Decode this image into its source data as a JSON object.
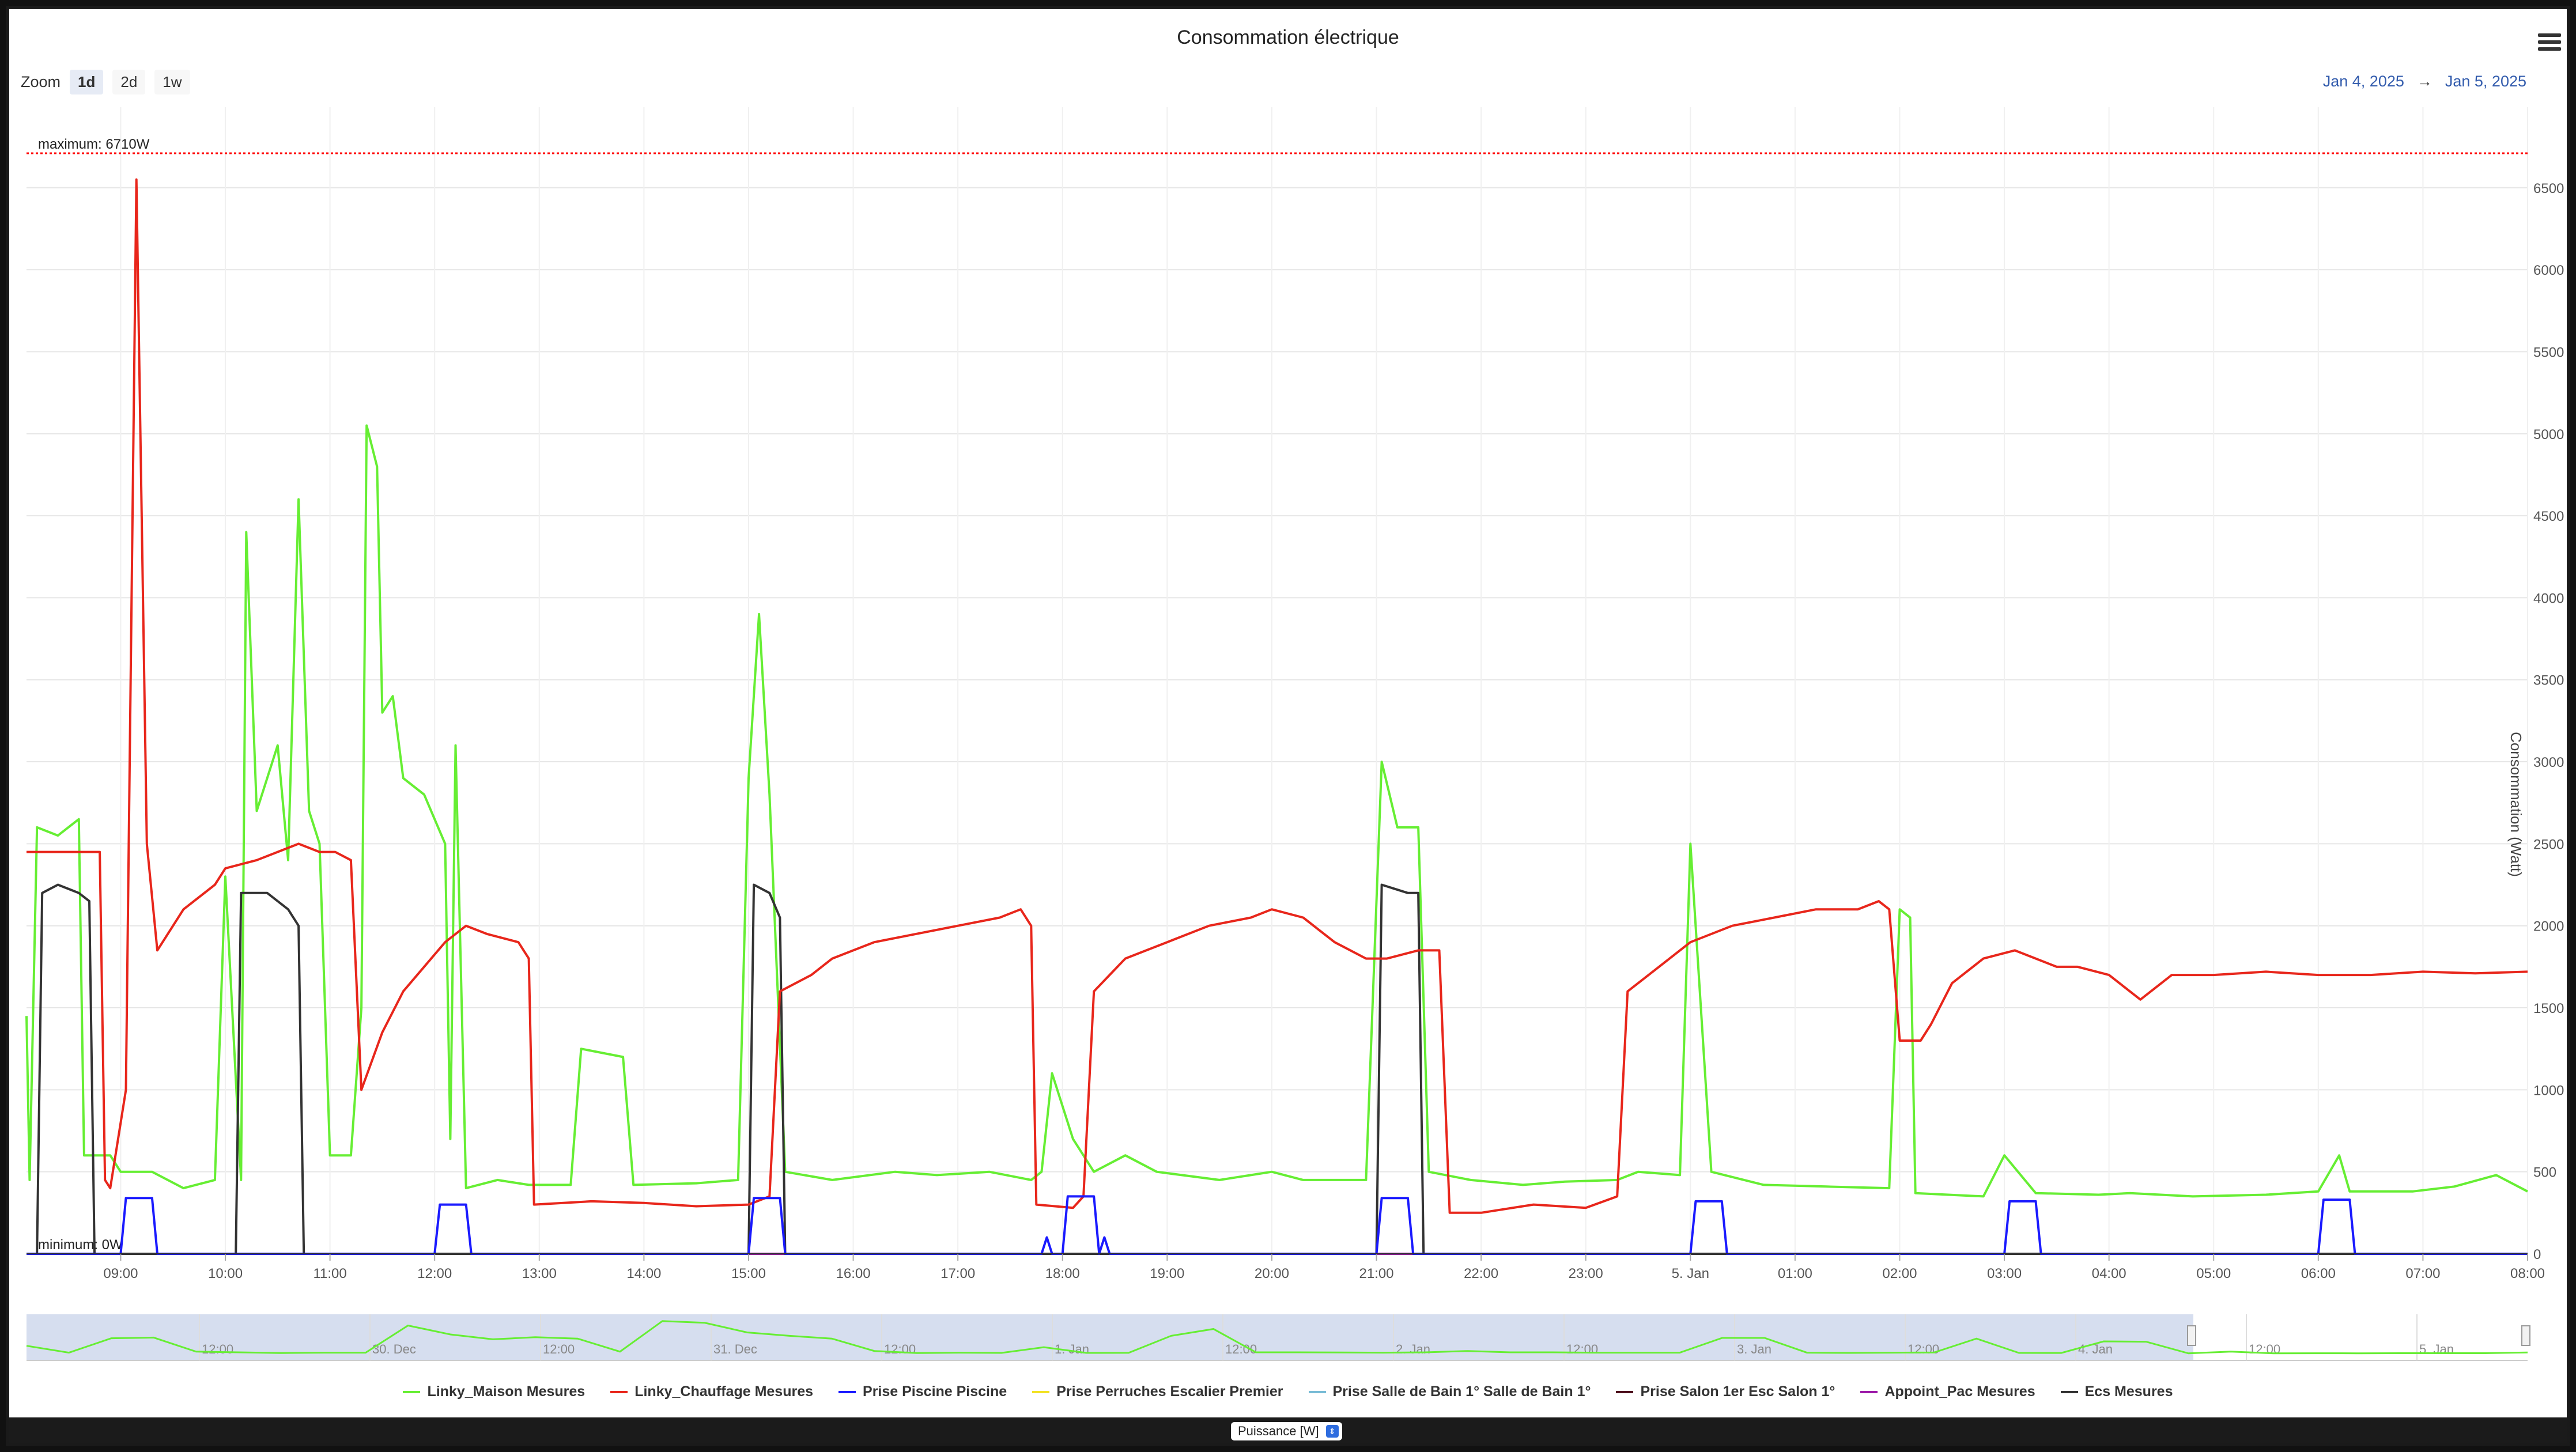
{
  "title": "Consommation électrique",
  "zoom": {
    "label": "Zoom",
    "options": [
      "1d",
      "2d",
      "1w"
    ],
    "selected": "1d"
  },
  "range": {
    "from": "Jan 4, 2025",
    "arrow": "→",
    "to": "Jan 5, 2025"
  },
  "unit_selector": "Puissance [W]",
  "navigator_labels": [
    "12:00",
    "30. Dec",
    "12:00",
    "31. Dec",
    "12:00",
    "1. Jan",
    "12:00",
    "2. Jan",
    "12:00",
    "3. Jan",
    "12:00",
    "4. Jan",
    "12:00",
    "5. Jan"
  ],
  "chart_data": {
    "type": "line",
    "title": "Consommation électrique",
    "ylabel": "Consommation (Watt)",
    "ylim": [
      0,
      6710
    ],
    "yticks": [
      0,
      500,
      1000,
      1500,
      2000,
      2500,
      3000,
      3500,
      4000,
      4500,
      5000,
      5500,
      6000,
      6500
    ],
    "xlim": [
      8.1,
      32.0
    ],
    "xticks": [
      {
        "v": 9,
        "label": "09:00"
      },
      {
        "v": 10,
        "label": "10:00"
      },
      {
        "v": 11,
        "label": "11:00"
      },
      {
        "v": 12,
        "label": "12:00"
      },
      {
        "v": 13,
        "label": "13:00"
      },
      {
        "v": 14,
        "label": "14:00"
      },
      {
        "v": 15,
        "label": "15:00"
      },
      {
        "v": 16,
        "label": "16:00"
      },
      {
        "v": 17,
        "label": "17:00"
      },
      {
        "v": 18,
        "label": "18:00"
      },
      {
        "v": 19,
        "label": "19:00"
      },
      {
        "v": 20,
        "label": "20:00"
      },
      {
        "v": 21,
        "label": "21:00"
      },
      {
        "v": 22,
        "label": "22:00"
      },
      {
        "v": 23,
        "label": "23:00"
      },
      {
        "v": 24,
        "label": "5. Jan"
      },
      {
        "v": 25,
        "label": "01:00"
      },
      {
        "v": 26,
        "label": "02:00"
      },
      {
        "v": 27,
        "label": "03:00"
      },
      {
        "v": 28,
        "label": "04:00"
      },
      {
        "v": 29,
        "label": "05:00"
      },
      {
        "v": 30,
        "label": "06:00"
      },
      {
        "v": 31,
        "label": "07:00"
      },
      {
        "v": 32,
        "label": "08:00"
      }
    ],
    "plotlines": [
      {
        "value": 6710,
        "label": "maximum: 6710W",
        "color": "#ff0000"
      },
      {
        "value": 0,
        "label": "minimum: 0W",
        "color": "#ff0000"
      }
    ],
    "grid": true,
    "legend_position": "bottom",
    "series": [
      {
        "name": "Linky_Maison Mesures",
        "color": "#66ee33",
        "points": [
          [
            8.1,
            1450
          ],
          [
            8.13,
            450
          ],
          [
            8.2,
            2600
          ],
          [
            8.4,
            2550
          ],
          [
            8.6,
            2650
          ],
          [
            8.65,
            600
          ],
          [
            8.9,
            600
          ],
          [
            9.0,
            500
          ],
          [
            9.3,
            500
          ],
          [
            9.6,
            400
          ],
          [
            9.9,
            450
          ],
          [
            10.0,
            2300
          ],
          [
            10.15,
            450
          ],
          [
            10.2,
            4400
          ],
          [
            10.3,
            2700
          ],
          [
            10.5,
            3100
          ],
          [
            10.6,
            2400
          ],
          [
            10.7,
            4600
          ],
          [
            10.8,
            2700
          ],
          [
            10.9,
            2500
          ],
          [
            11.0,
            600
          ],
          [
            11.2,
            600
          ],
          [
            11.3,
            1500
          ],
          [
            11.35,
            5050
          ],
          [
            11.45,
            4800
          ],
          [
            11.5,
            3300
          ],
          [
            11.6,
            3400
          ],
          [
            11.7,
            2900
          ],
          [
            11.9,
            2800
          ],
          [
            12.1,
            2500
          ],
          [
            12.15,
            700
          ],
          [
            12.2,
            3100
          ],
          [
            12.3,
            400
          ],
          [
            12.6,
            450
          ],
          [
            12.9,
            420
          ],
          [
            13.3,
            420
          ],
          [
            13.4,
            1250
          ],
          [
            13.8,
            1200
          ],
          [
            13.9,
            420
          ],
          [
            14.5,
            430
          ],
          [
            14.9,
            450
          ],
          [
            15.0,
            2900
          ],
          [
            15.1,
            3900
          ],
          [
            15.2,
            2800
          ],
          [
            15.35,
            500
          ],
          [
            15.8,
            450
          ],
          [
            16.4,
            500
          ],
          [
            16.8,
            480
          ],
          [
            17.3,
            500
          ],
          [
            17.7,
            450
          ],
          [
            17.8,
            500
          ],
          [
            17.9,
            1100
          ],
          [
            18.1,
            700
          ],
          [
            18.3,
            500
          ],
          [
            18.6,
            600
          ],
          [
            18.9,
            500
          ],
          [
            19.5,
            450
          ],
          [
            20.0,
            500
          ],
          [
            20.3,
            450
          ],
          [
            20.9,
            450
          ],
          [
            21.05,
            3000
          ],
          [
            21.2,
            2600
          ],
          [
            21.4,
            2600
          ],
          [
            21.5,
            500
          ],
          [
            21.9,
            450
          ],
          [
            22.4,
            420
          ],
          [
            22.8,
            440
          ],
          [
            23.3,
            450
          ],
          [
            23.5,
            500
          ],
          [
            23.9,
            480
          ],
          [
            24.0,
            2500
          ],
          [
            24.2,
            500
          ],
          [
            24.7,
            420
          ],
          [
            25.3,
            410
          ],
          [
            25.9,
            400
          ],
          [
            26.0,
            2100
          ],
          [
            26.1,
            2050
          ],
          [
            26.15,
            370
          ],
          [
            26.8,
            350
          ],
          [
            27.0,
            600
          ],
          [
            27.3,
            370
          ],
          [
            27.9,
            360
          ],
          [
            28.2,
            370
          ],
          [
            28.8,
            350
          ],
          [
            29.5,
            360
          ],
          [
            30.0,
            380
          ],
          [
            30.2,
            600
          ],
          [
            30.3,
            380
          ],
          [
            30.9,
            380
          ],
          [
            31.3,
            410
          ],
          [
            31.7,
            480
          ],
          [
            32.0,
            380
          ]
        ]
      },
      {
        "name": "Linky_Chauffage Mesures",
        "color": "#e8261b",
        "points": [
          [
            8.1,
            2450
          ],
          [
            8.5,
            2450
          ],
          [
            8.8,
            2450
          ],
          [
            8.85,
            450
          ],
          [
            8.9,
            400
          ],
          [
            9.05,
            1000
          ],
          [
            9.15,
            6550
          ],
          [
            9.25,
            2500
          ],
          [
            9.35,
            1850
          ],
          [
            9.6,
            2100
          ],
          [
            9.9,
            2250
          ],
          [
            10.0,
            2350
          ],
          [
            10.3,
            2400
          ],
          [
            10.5,
            2450
          ],
          [
            10.7,
            2500
          ],
          [
            10.9,
            2450
          ],
          [
            11.05,
            2450
          ],
          [
            11.2,
            2400
          ],
          [
            11.3,
            1000
          ],
          [
            11.5,
            1350
          ],
          [
            11.7,
            1600
          ],
          [
            11.9,
            1750
          ],
          [
            12.1,
            1900
          ],
          [
            12.3,
            2000
          ],
          [
            12.5,
            1950
          ],
          [
            12.8,
            1900
          ],
          [
            12.9,
            1800
          ],
          [
            12.95,
            300
          ],
          [
            13.5,
            320
          ],
          [
            14.0,
            310
          ],
          [
            14.5,
            290
          ],
          [
            15.0,
            300
          ],
          [
            15.2,
            350
          ],
          [
            15.3,
            1600
          ],
          [
            15.6,
            1700
          ],
          [
            15.8,
            1800
          ],
          [
            16.2,
            1900
          ],
          [
            16.6,
            1950
          ],
          [
            17.0,
            2000
          ],
          [
            17.4,
            2050
          ],
          [
            17.6,
            2100
          ],
          [
            17.7,
            2000
          ],
          [
            17.75,
            300
          ],
          [
            18.1,
            280
          ],
          [
            18.2,
            350
          ],
          [
            18.3,
            1600
          ],
          [
            18.6,
            1800
          ],
          [
            19.0,
            1900
          ],
          [
            19.4,
            2000
          ],
          [
            19.8,
            2050
          ],
          [
            20.0,
            2100
          ],
          [
            20.3,
            2050
          ],
          [
            20.6,
            1900
          ],
          [
            20.9,
            1800
          ],
          [
            21.1,
            1800
          ],
          [
            21.4,
            1850
          ],
          [
            21.6,
            1850
          ],
          [
            21.7,
            250
          ],
          [
            22.0,
            250
          ],
          [
            22.5,
            300
          ],
          [
            23.0,
            280
          ],
          [
            23.3,
            350
          ],
          [
            23.4,
            1600
          ],
          [
            23.7,
            1750
          ],
          [
            24.0,
            1900
          ],
          [
            24.4,
            2000
          ],
          [
            24.8,
            2050
          ],
          [
            25.2,
            2100
          ],
          [
            25.6,
            2100
          ],
          [
            25.8,
            2150
          ],
          [
            25.9,
            2100
          ],
          [
            26.0,
            1300
          ],
          [
            26.2,
            1300
          ],
          [
            26.3,
            1400
          ],
          [
            26.5,
            1650
          ],
          [
            26.8,
            1800
          ],
          [
            27.1,
            1850
          ],
          [
            27.3,
            1800
          ],
          [
            27.5,
            1750
          ],
          [
            27.7,
            1750
          ],
          [
            28.0,
            1700
          ],
          [
            28.3,
            1550
          ],
          [
            28.6,
            1700
          ],
          [
            29.0,
            1700
          ],
          [
            29.5,
            1720
          ],
          [
            30.0,
            1700
          ],
          [
            30.5,
            1700
          ],
          [
            31.0,
            1720
          ],
          [
            31.5,
            1710
          ],
          [
            32.0,
            1720
          ]
        ]
      },
      {
        "name": "Prise Piscine Piscine",
        "color": "#1a1aff",
        "points": [
          [
            8.1,
            0
          ],
          [
            9.0,
            0
          ],
          [
            9.05,
            340
          ],
          [
            9.3,
            340
          ],
          [
            9.35,
            0
          ],
          [
            12.0,
            0
          ],
          [
            12.05,
            300
          ],
          [
            12.3,
            300
          ],
          [
            12.35,
            0
          ],
          [
            15.0,
            0
          ],
          [
            15.05,
            340
          ],
          [
            15.3,
            340
          ],
          [
            15.35,
            0
          ],
          [
            17.8,
            0
          ],
          [
            17.85,
            100
          ],
          [
            17.9,
            0
          ],
          [
            18.0,
            0
          ],
          [
            18.05,
            350
          ],
          [
            18.3,
            350
          ],
          [
            18.35,
            0
          ],
          [
            18.4,
            100
          ],
          [
            18.45,
            0
          ],
          [
            21.0,
            0
          ],
          [
            21.05,
            340
          ],
          [
            21.3,
            340
          ],
          [
            21.35,
            0
          ],
          [
            24.0,
            0
          ],
          [
            24.05,
            320
          ],
          [
            24.3,
            320
          ],
          [
            24.35,
            0
          ],
          [
            27.0,
            0
          ],
          [
            27.05,
            320
          ],
          [
            27.3,
            320
          ],
          [
            27.35,
            0
          ],
          [
            30.0,
            0
          ],
          [
            30.05,
            330
          ],
          [
            30.3,
            330
          ],
          [
            30.35,
            0
          ],
          [
            32.0,
            0
          ]
        ]
      },
      {
        "name": "Prise Perruches Escalier Premier",
        "color": "#f2e224",
        "points": [
          [
            8.1,
            0
          ],
          [
            32.0,
            0
          ]
        ]
      },
      {
        "name": "Prise Salle de Bain 1° Salle de Bain 1°",
        "color": "#78bbd6",
        "points": [
          [
            8.1,
            0
          ],
          [
            32.0,
            0
          ]
        ]
      },
      {
        "name": "Prise Salon 1er Esc Salon 1°",
        "color": "#4d0f1c",
        "points": [
          [
            8.1,
            0
          ],
          [
            32.0,
            0
          ]
        ]
      },
      {
        "name": "Appoint_Pac Mesures",
        "color": "#9c1aa8",
        "points": [
          [
            8.1,
            0
          ],
          [
            32.0,
            0
          ]
        ]
      },
      {
        "name": "Ecs Mesures",
        "color": "#333333",
        "points": [
          [
            8.1,
            0
          ],
          [
            8.2,
            0
          ],
          [
            8.25,
            2200
          ],
          [
            8.4,
            2250
          ],
          [
            8.6,
            2200
          ],
          [
            8.7,
            2150
          ],
          [
            8.75,
            0
          ],
          [
            10.1,
            0
          ],
          [
            10.15,
            2200
          ],
          [
            10.4,
            2200
          ],
          [
            10.6,
            2100
          ],
          [
            10.7,
            2000
          ],
          [
            10.75,
            0
          ],
          [
            15.0,
            0
          ],
          [
            15.05,
            2250
          ],
          [
            15.2,
            2200
          ],
          [
            15.3,
            2050
          ],
          [
            15.35,
            0
          ],
          [
            21.0,
            0
          ],
          [
            21.05,
            2250
          ],
          [
            21.3,
            2200
          ],
          [
            21.4,
            2200
          ],
          [
            21.45,
            0
          ],
          [
            32.0,
            0
          ]
        ]
      }
    ]
  }
}
